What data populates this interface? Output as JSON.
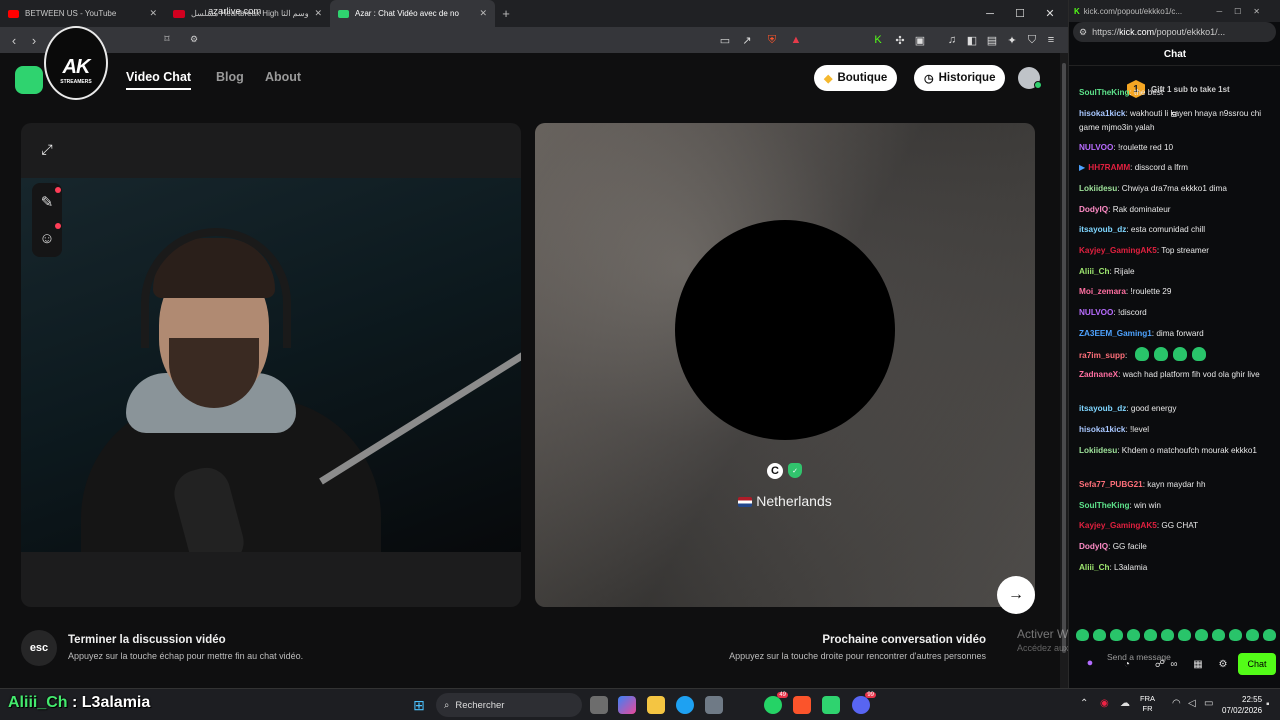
{
  "browser": {
    "tabs": [
      {
        "title": "BETWEEN US - YouTube",
        "color": "#ff0000"
      },
      {
        "title": "مسلسل Heartbreak High الموسم الثا",
        "color": "#d1001f"
      },
      {
        "title": "Azar : Chat Vidéo avec de no",
        "color": "#2fd36f"
      }
    ],
    "new_tab": "+",
    "url": "azarlive.com"
  },
  "site": {
    "logo_overlay": {
      "line1": "AK",
      "line2": "STREAMERS"
    },
    "nav": [
      "Video Chat",
      "Blog",
      "About"
    ],
    "buttons": {
      "boutique": "Boutique",
      "historique": "Historique"
    },
    "remote": {
      "initial": "C",
      "country": "Netherlands"
    },
    "footer": {
      "esc_key": "esc",
      "end_title": "Terminer la discussion vidéo",
      "end_sub": "Appuyez sur la touche échap pour mettre fin au chat vidéo.",
      "next_title": "Prochaine conversation vidéo",
      "next_sub": "Appuyez sur la touche droite pour rencontrer d'autres personnes"
    },
    "watermark": {
      "line1": "Activer Windows",
      "line2": "Accédez aux paramètres pour activer Windows."
    }
  },
  "kick": {
    "window_title": "kick.com/popout/ekkko1/c...",
    "url_prefix": "https://",
    "url_domain": "kick.com",
    "url_rest": "/popout/ekkko1/...",
    "header": "Chat",
    "gift_number": "1",
    "gift_text": "Gift 1 sub to take 1st",
    "messages": [
      {
        "user": "SoulTheKing",
        "text": "the best",
        "color": "#5de28a"
      },
      {
        "user": "hisoka1kick",
        "text": "wakhouti li kayen hnaya n9ssrou chi game mjmo3in yalah",
        "color": "#a8c7ff"
      },
      {
        "user": "NULVOO",
        "text": "!roulette red 10",
        "color": "#b86cff"
      },
      {
        "user": "HH7RAMM",
        "text": "disscord a lfrm",
        "color": "#e0203f"
      },
      {
        "user": "Lokiidesu",
        "text": "Chwiya dra7ma ekkko1 dima",
        "color": "#9ee29a"
      },
      {
        "user": "DodyIQ",
        "text": "Rak dominateur",
        "color": "#ff8cc6"
      },
      {
        "user": "itsayoub_dz",
        "text": "esta comunidad chill",
        "color": "#7fd6ff"
      },
      {
        "user": "Kayjey_GamingAK5",
        "text": "Top streamer",
        "color": "#e0203f"
      },
      {
        "user": "Aliii_Ch",
        "text": "Rijale",
        "color": "#9fe870"
      },
      {
        "user": "Moi_zemara",
        "text": "!roulette 29",
        "color": "#ff6fa1"
      },
      {
        "user": "NULVOO",
        "text": "!discord",
        "color": "#b86cff"
      },
      {
        "user": "ZA3EEM_Gaming1",
        "text": "dima forward",
        "color": "#4ea3ff"
      },
      {
        "user": "ra7im_supp",
        "text": "",
        "color": "#ff6f7a"
      },
      {
        "user": "ZadnaneX",
        "text": "wach had platform fih vod ola ghir live",
        "color": "#ff6fa1"
      },
      {
        "user": "itsayoub_dz",
        "text": "good energy",
        "color": "#7fd6ff"
      },
      {
        "user": "hisoka1kick",
        "text": "!level",
        "color": "#a8c7ff"
      },
      {
        "user": "Lokiidesu",
        "text": "Khdem o matchoufch mourak ekkko1",
        "color": "#9ee29a"
      },
      {
        "user": "Sefa77_PUBG21",
        "text": "kayn maydar hh",
        "color": "#ff6f7a"
      },
      {
        "user": "SoulTheKing",
        "text": "win win",
        "color": "#5de28a"
      },
      {
        "user": "Kayjey_GamingAK5",
        "text": "GG CHAT",
        "color": "#e0203f"
      },
      {
        "user": "DodyIQ",
        "text": "GG facile",
        "color": "#ff8cc6"
      },
      {
        "user": "Aliii_Ch",
        "text": "L3alamia",
        "color": "#9fe870"
      }
    ],
    "input_placeholder": "Send a message",
    "chat_button": "Chat"
  },
  "caption": {
    "name": "Aliii_Ch",
    "text": " : L3alamia"
  },
  "taskbar": {
    "search": "Rechercher",
    "lang1": "FRA",
    "lang2": "FR",
    "time": "22:55",
    "date": "07/02/2026",
    "badges": {
      "whatsapp": "49",
      "discord": "99"
    }
  }
}
